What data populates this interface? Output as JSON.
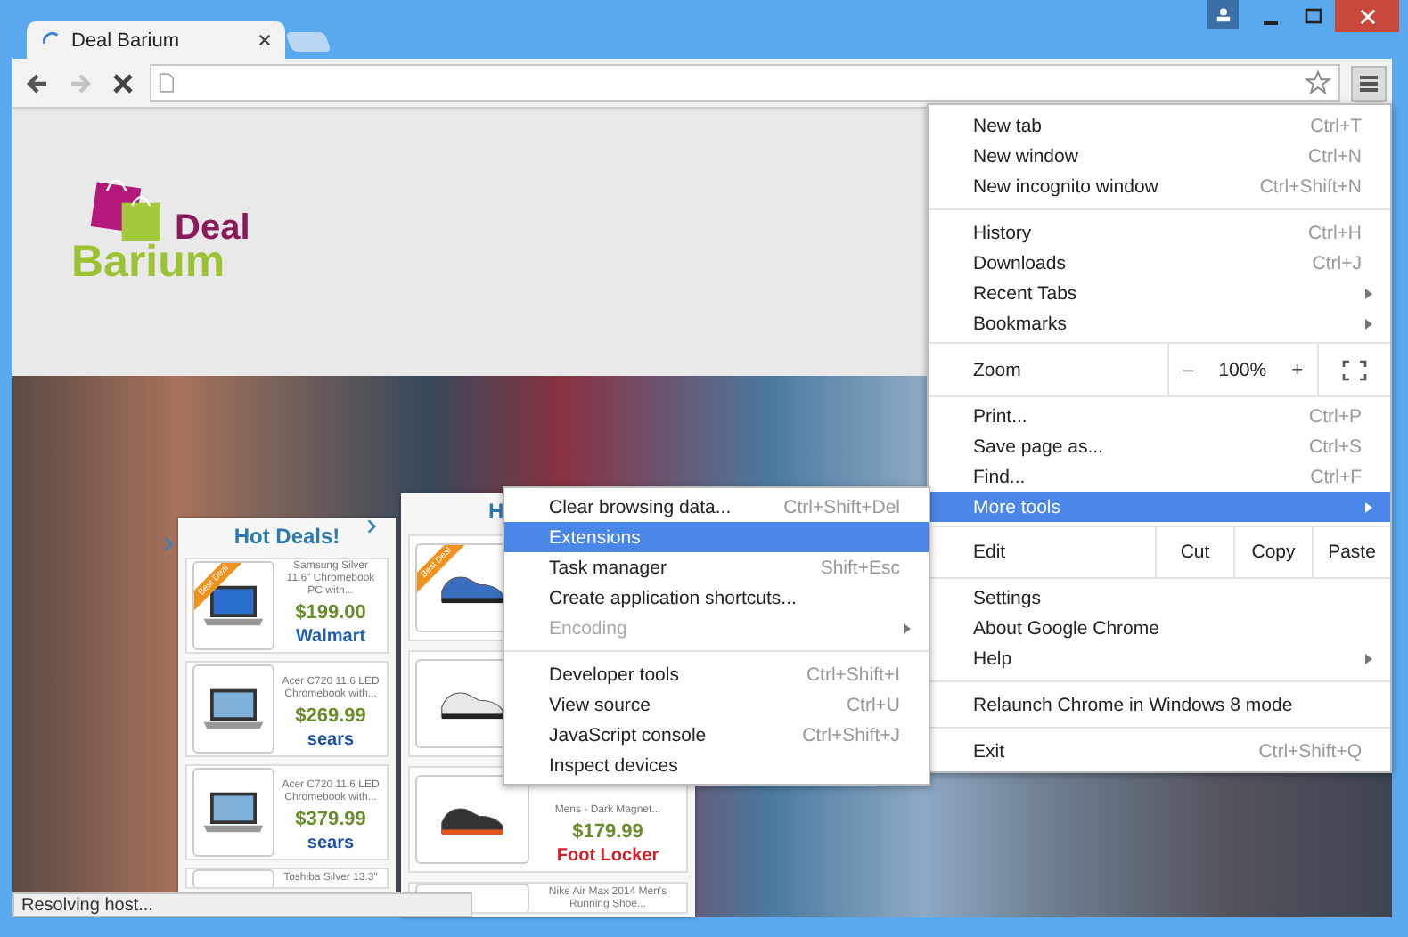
{
  "window": {
    "tab_title": "Deal Barium"
  },
  "nav": [
    {
      "kind": "back",
      "disabled": false
    },
    {
      "kind": "forward",
      "disabled": true
    },
    {
      "kind": "stop",
      "disabled": false
    }
  ],
  "page": {
    "logo": {
      "line_1": "Deal",
      "line_2": "Barium"
    },
    "deal_panels": [
      {
        "heading": "Hot Deals!",
        "items": [
          {
            "kind": "laptop",
            "ribbon": "Best Deal",
            "title": "Samsung Silver 11.6\" Chromebook PC with...",
            "price": "$199.00",
            "store": "Walmart",
            "color": "#1f5fb0"
          },
          {
            "kind": "laptop",
            "title": "Acer C720 11.6 LED Chromebook with...",
            "price": "$269.99",
            "store": "sears",
            "color": "#1d4fa8"
          },
          {
            "kind": "laptop",
            "title": "Acer C720 11.6 LED Chromebook with...",
            "price": "$379.99",
            "store": "sears",
            "color": "#1d4fa8"
          },
          {
            "title": "Toshiba Silver 13.3\""
          }
        ]
      },
      {
        "heading": "H",
        "items": [
          {
            "kind": "shoe",
            "ribbon": "Best Deal"
          },
          {
            "kind": "shoe"
          },
          {
            "kind": "shoe",
            "title": "Mens - Dark Magnet...",
            "price": "$179.99",
            "store": "Foot Locker",
            "color": "#d81e2a"
          },
          {
            "title": "Nike Air Max 2014 Men's Running Shoe..."
          }
        ]
      }
    ]
  },
  "menu": {
    "items": [
      {
        "kind": "item",
        "label": "New tab",
        "shortcut": "Ctrl+T",
        "submenu": false,
        "selected": false
      },
      {
        "kind": "item",
        "label": "New window",
        "shortcut": "Ctrl+N",
        "submenu": false,
        "selected": false
      },
      {
        "kind": "item",
        "label": "New incognito window",
        "shortcut": "Ctrl+Shift+N",
        "submenu": false,
        "selected": false
      },
      {
        "kind": "separator"
      },
      {
        "kind": "item",
        "label": "History",
        "shortcut": "Ctrl+H",
        "submenu": false,
        "selected": false
      },
      {
        "kind": "item",
        "label": "Downloads",
        "shortcut": "Ctrl+J",
        "submenu": false,
        "selected": false
      },
      {
        "kind": "item",
        "label": "Recent Tabs",
        "submenu": true,
        "selected": false
      },
      {
        "kind": "item",
        "label": "Bookmarks",
        "submenu": true,
        "selected": false
      },
      {
        "kind": "zoom",
        "label": "Zoom",
        "minus": "–",
        "value": "100%",
        "plus": "+"
      },
      {
        "kind": "item",
        "label": "Print...",
        "shortcut": "Ctrl+P",
        "submenu": false,
        "selected": false
      },
      {
        "kind": "item",
        "label": "Save page as...",
        "shortcut": "Ctrl+S",
        "submenu": false,
        "selected": false
      },
      {
        "kind": "item",
        "label": "Find...",
        "shortcut": "Ctrl+F",
        "submenu": false,
        "selected": false
      },
      {
        "kind": "item",
        "label": "More tools",
        "submenu": true,
        "selected": true
      },
      {
        "kind": "edit",
        "label": "Edit",
        "buttons": [
          "Cut",
          "Copy",
          "Paste"
        ]
      },
      {
        "kind": "item",
        "label": "Settings",
        "submenu": false,
        "selected": false
      },
      {
        "kind": "item",
        "label": "About Google Chrome",
        "submenu": false,
        "selected": false
      },
      {
        "kind": "item",
        "label": "Help",
        "submenu": true,
        "selected": false
      },
      {
        "kind": "separator"
      },
      {
        "kind": "item",
        "label": "Relaunch Chrome in Windows 8 mode",
        "submenu": false,
        "selected": false
      },
      {
        "kind": "separator"
      },
      {
        "kind": "item",
        "label": "Exit",
        "shortcut": "Ctrl+Shift+Q",
        "submenu": false,
        "selected": false
      }
    ]
  },
  "submenu": {
    "items": [
      {
        "kind": "item",
        "label": "Clear browsing data...",
        "shortcut": "Ctrl+Shift+Del",
        "submenu": false,
        "selected": false,
        "disabled": false
      },
      {
        "kind": "item",
        "label": "Extensions",
        "submenu": false,
        "selected": true,
        "disabled": false
      },
      {
        "kind": "item",
        "label": "Task manager",
        "shortcut": "Shift+Esc",
        "submenu": false,
        "selected": false,
        "disabled": false
      },
      {
        "kind": "item",
        "label": "Create application shortcuts...",
        "submenu": false,
        "selected": false,
        "disabled": false
      },
      {
        "kind": "item",
        "label": "Encoding",
        "submenu": true,
        "selected": false,
        "disabled": true
      },
      {
        "kind": "separator"
      },
      {
        "kind": "item",
        "label": "Developer tools",
        "shortcut": "Ctrl+Shift+I",
        "submenu": false,
        "selected": false,
        "disabled": false
      },
      {
        "kind": "item",
        "label": "View source",
        "shortcut": "Ctrl+U",
        "submenu": false,
        "selected": false,
        "disabled": false
      },
      {
        "kind": "item",
        "label": "JavaScript console",
        "shortcut": "Ctrl+Shift+J",
        "submenu": false,
        "selected": false,
        "disabled": false
      },
      {
        "kind": "item",
        "label": "Inspect devices",
        "submenu": false,
        "selected": false,
        "disabled": false
      }
    ]
  },
  "status_bar": {
    "text": "Resolving host..."
  }
}
